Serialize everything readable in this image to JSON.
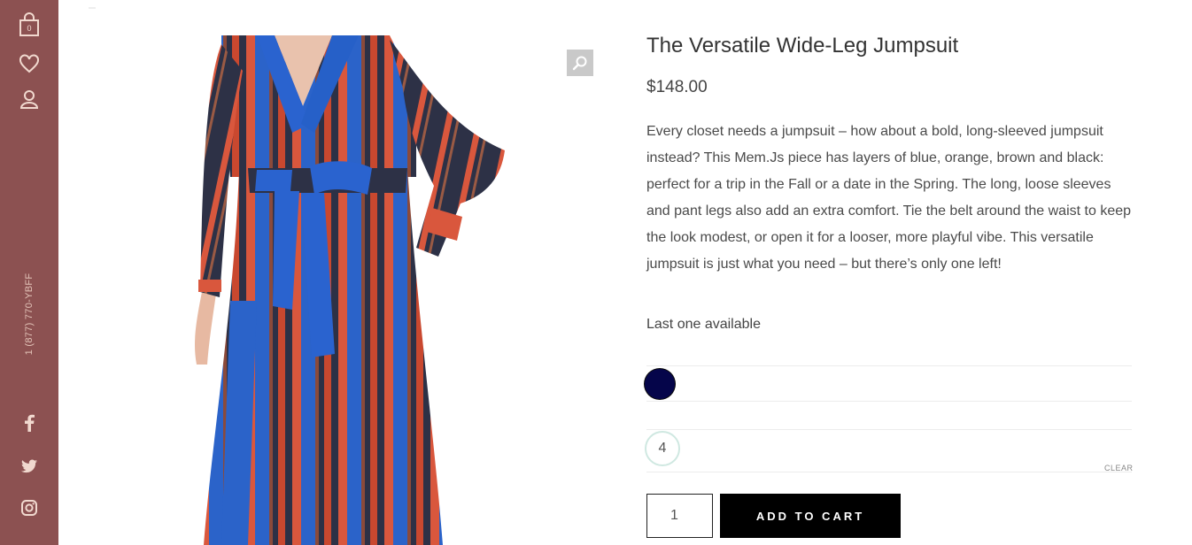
{
  "sidebar": {
    "cart_count": "0",
    "phone": "1 (877) 770-YBFF",
    "icons": [
      "shopping-bag-icon",
      "heart-icon",
      "user-icon",
      "facebook-icon",
      "twitter-icon",
      "instagram-icon"
    ],
    "background": "#8c5151"
  },
  "product": {
    "title": "The Versatile Wide-Leg Jumpsuit",
    "price": "$148.00",
    "description": "Every closet needs a jumpsuit – how about a bold, long-sleeved jumpsuit instead? This Mem.Js piece has layers of blue, orange, brown and black: perfect for a trip in the Fall or a date in the Spring. The long, loose sleeves and pant legs also add an extra comfort. Tie the belt around the waist to keep the look modest, or open it for a looser, more playful vibe. This versatile jumpsuit is just what you need – but there’s only one left!",
    "stock": "Last one available",
    "color_swatch": "#05054a",
    "size": "4",
    "clear_label": "CLEAR",
    "quantity": "1",
    "add_to_cart_label": "ADD TO CART"
  }
}
